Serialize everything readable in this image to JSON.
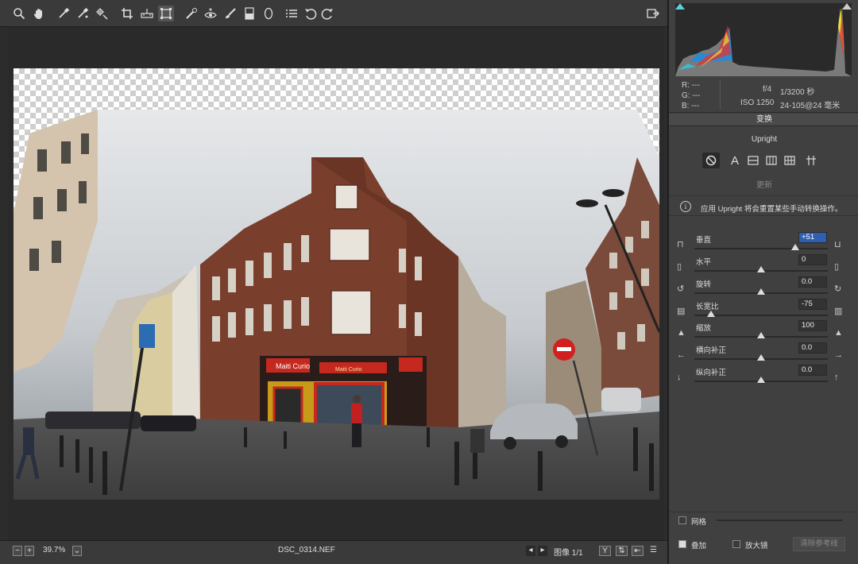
{
  "toolbar": {
    "tools": [
      "zoom-icon",
      "hand-icon",
      "white-balance-icon",
      "color-sampler-icon",
      "target-adjust-icon",
      "crop-icon",
      "straighten-icon",
      "transform-icon",
      "spot-removal-icon",
      "red-eye-icon",
      "adjustment-brush-icon",
      "graduated-filter-icon",
      "radial-filter-icon",
      "presets-icon",
      "rotate-left-icon",
      "rotate-right-icon"
    ]
  },
  "status": {
    "zoom": "39.7%",
    "filename": "DSC_0314.NEF",
    "image_count": "图像 1/1"
  },
  "info": {
    "r": "R:   ---",
    "g": "G:   ---",
    "b": "B:   ---",
    "aperture": "f/4",
    "shutter": "1/3200 秒",
    "iso": "ISO 1250",
    "lens": "24-105@24 毫米"
  },
  "panel": {
    "title": "变换",
    "upright_label": "Upright",
    "auto_label": "A",
    "update_label": "更新",
    "notice": "应用 Upright 将会重置某些手动转换操作。"
  },
  "sliders": [
    {
      "label": "垂直",
      "value": "+51",
      "level": 0.755,
      "selected": true
    },
    {
      "label": "水平",
      "value": "0",
      "level": 0.5,
      "selected": false
    },
    {
      "label": "旋转",
      "value": "0.0",
      "level": 0.5,
      "selected": false
    },
    {
      "label": "长宽比",
      "value": "-75",
      "level": 0.125,
      "selected": false
    },
    {
      "label": "缩放",
      "value": "100",
      "level": 0.5,
      "selected": false
    },
    {
      "label": "横向补正",
      "value": "0.0",
      "level": 0.5,
      "selected": false
    },
    {
      "label": "纵向补正",
      "value": "0.0",
      "level": 0.5,
      "selected": false
    }
  ],
  "bottom": {
    "grid_label": "网格",
    "overlay_label": "叠加",
    "loupe_label": "放大镜",
    "clear_guides": "清除参考线"
  },
  "storefront": {
    "sign_left": "Maiti Curio",
    "sign_center": "Maiti Curio"
  }
}
